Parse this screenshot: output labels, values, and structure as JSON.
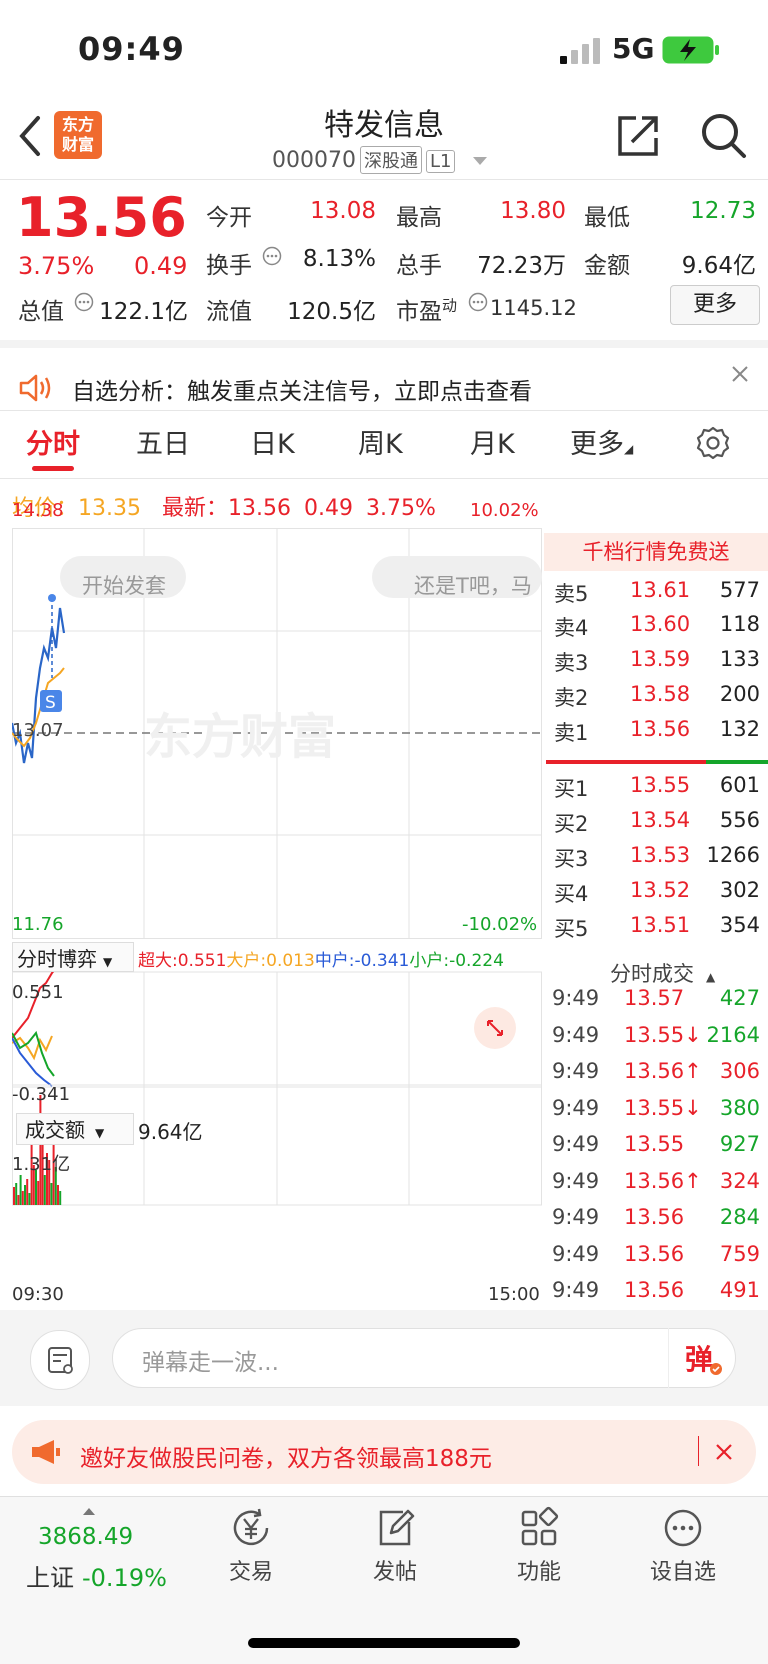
{
  "status_bar": {
    "time": "09:49",
    "network": "5G"
  },
  "header": {
    "name": "特发信息",
    "code": "000070",
    "tags": [
      "深股通",
      "L1"
    ],
    "logo_text": "东方\n财富"
  },
  "quote": {
    "price": "13.56",
    "pct": "3.75%",
    "change": "0.49",
    "open_label": "今开",
    "open": "13.08",
    "high_label": "最高",
    "high": "13.80",
    "low_label": "最低",
    "low": "12.73",
    "turnover_label": "换手",
    "turnover": "8.13%",
    "volume_label": "总手",
    "volume": "72.23万",
    "amount_label": "金额",
    "amount": "9.64亿",
    "mktcap_label": "总值",
    "mktcap": "122.1亿",
    "float_label": "流值",
    "float": "120.5亿",
    "pe_label": "市盈",
    "pe_sup": "动",
    "pe": "1145.12",
    "more_label": "更多"
  },
  "notice": {
    "text": "自选分析：触发重点关注信号，立即点击查看"
  },
  "tabs": [
    "分时",
    "五日",
    "日K",
    "周K",
    "月K",
    "更多"
  ],
  "avg_line": {
    "avg_label": "均价：",
    "avg": "13.35",
    "latest_label": "最新：",
    "latest": "13.56",
    "chg": "0.49",
    "pct": "3.75%"
  },
  "chart": {
    "top_price": "14.38",
    "top_pct": "10.02%",
    "mid_price": "13.07",
    "bottom_price": "11.76",
    "bottom_pct": "-10.02%",
    "bubble1": "开始发套",
    "bubble2": "还是T吧，马",
    "watermark": "东方财富",
    "flow_label": "分时博弈",
    "flow": [
      {
        "name": "超大:",
        "value": "0.551",
        "color": "#e8212a"
      },
      {
        "name": "大户:",
        "value": "0.013",
        "color": "#f5a623"
      },
      {
        "name": "中户:",
        "value": "-0.341",
        "color": "#2a5bd7"
      },
      {
        "name": "小户:",
        "value": "-0.224",
        "color": "#15a52a"
      }
    ],
    "flow_max": "0.551",
    "flow_min": "-0.341",
    "amount_label": "成交额",
    "amount_total": "9.64亿",
    "amount_max": "1.31亿",
    "time_start": "09:30",
    "time_end": "15:00"
  },
  "orderbook": {
    "promo": "千档行情免费送",
    "asks": [
      {
        "label": "卖5",
        "price": "13.61",
        "vol": "577"
      },
      {
        "label": "卖4",
        "price": "13.60",
        "vol": "118"
      },
      {
        "label": "卖3",
        "price": "13.59",
        "vol": "133"
      },
      {
        "label": "卖2",
        "price": "13.58",
        "vol": "200"
      },
      {
        "label": "卖1",
        "price": "13.56",
        "vol": "132"
      }
    ],
    "bids": [
      {
        "label": "买1",
        "price": "13.55",
        "vol": "601"
      },
      {
        "label": "买2",
        "price": "13.54",
        "vol": "556"
      },
      {
        "label": "买3",
        "price": "13.53",
        "vol": "1266"
      },
      {
        "label": "买4",
        "price": "13.52",
        "vol": "302"
      },
      {
        "label": "买5",
        "price": "13.51",
        "vol": "354"
      }
    ],
    "ticks_title": "分时成交",
    "ticks": [
      {
        "time": "9:49",
        "price": "13.57",
        "vol": "427",
        "color": "#e8212a",
        "arrow": "",
        "vcolor": "#15a52a"
      },
      {
        "time": "9:49",
        "price": "13.55↓",
        "vol": "2164",
        "color": "#e8212a",
        "arrow": "",
        "vcolor": "#15a52a"
      },
      {
        "time": "9:49",
        "price": "13.56↑",
        "vol": "306",
        "color": "#e8212a",
        "arrow": "",
        "vcolor": "#e8212a"
      },
      {
        "time": "9:49",
        "price": "13.55↓",
        "vol": "380",
        "color": "#e8212a",
        "arrow": "",
        "vcolor": "#15a52a"
      },
      {
        "time": "9:49",
        "price": "13.55",
        "vol": "927",
        "color": "#e8212a",
        "arrow": "",
        "vcolor": "#15a52a"
      },
      {
        "time": "9:49",
        "price": "13.56↑",
        "vol": "324",
        "color": "#e8212a",
        "arrow": "",
        "vcolor": "#e8212a"
      },
      {
        "time": "9:49",
        "price": "13.56",
        "vol": "284",
        "color": "#e8212a",
        "arrow": "",
        "vcolor": "#15a52a"
      },
      {
        "time": "9:49",
        "price": "13.56",
        "vol": "759",
        "color": "#e8212a",
        "arrow": "",
        "vcolor": "#e8212a"
      },
      {
        "time": "9:49",
        "price": "13.56",
        "vol": "491",
        "color": "#e8212a",
        "arrow": "",
        "vcolor": "#e8212a"
      }
    ]
  },
  "danmu": {
    "placeholder": "弹幕走一波...",
    "send_label": "弹"
  },
  "invite": {
    "text": "邀好友做股民问卷，双方各领最高188元"
  },
  "nav": {
    "index_value": "3868.49",
    "index_name": "上证",
    "index_pct": "-0.19%",
    "items": [
      "交易",
      "发帖",
      "功能",
      "设自选"
    ]
  }
}
